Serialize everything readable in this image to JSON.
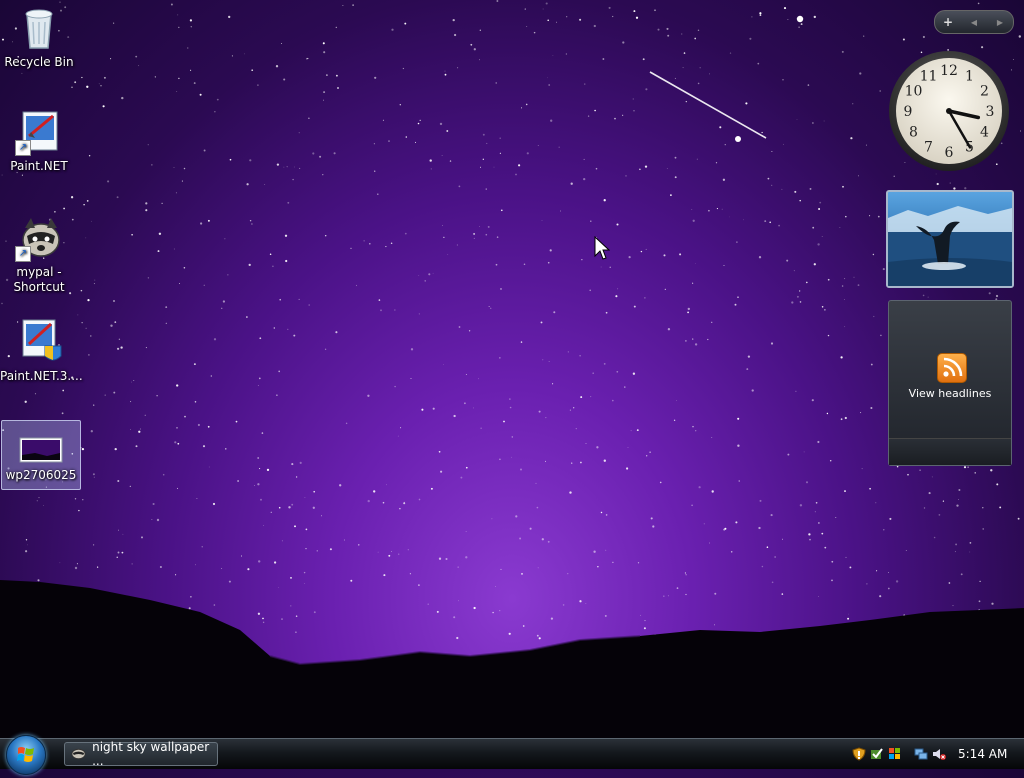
{
  "desktop": {
    "icons": [
      {
        "label": "Recycle Bin"
      },
      {
        "label": "Paint.NET"
      },
      {
        "label": "mypal - Shortcut"
      },
      {
        "label": "Paint.NET.3...."
      },
      {
        "label": "wp2706025"
      }
    ]
  },
  "gadgets": {
    "toolbar": {
      "add": "+",
      "prev": "◀",
      "next": "▶"
    },
    "clock": {
      "time": "3:25",
      "numerals": [
        "12",
        "1",
        "2",
        "3",
        "4",
        "5",
        "6",
        "7",
        "8",
        "9",
        "10",
        "11"
      ]
    },
    "feed": {
      "label": "View headlines"
    }
  },
  "taskbar": {
    "task_button": "night sky wallpaper ...",
    "tray_time": "5:14 AM"
  },
  "colors": {
    "sky": "#4a1286",
    "taskbar": "#14181d",
    "rss": "#f08a1c"
  }
}
